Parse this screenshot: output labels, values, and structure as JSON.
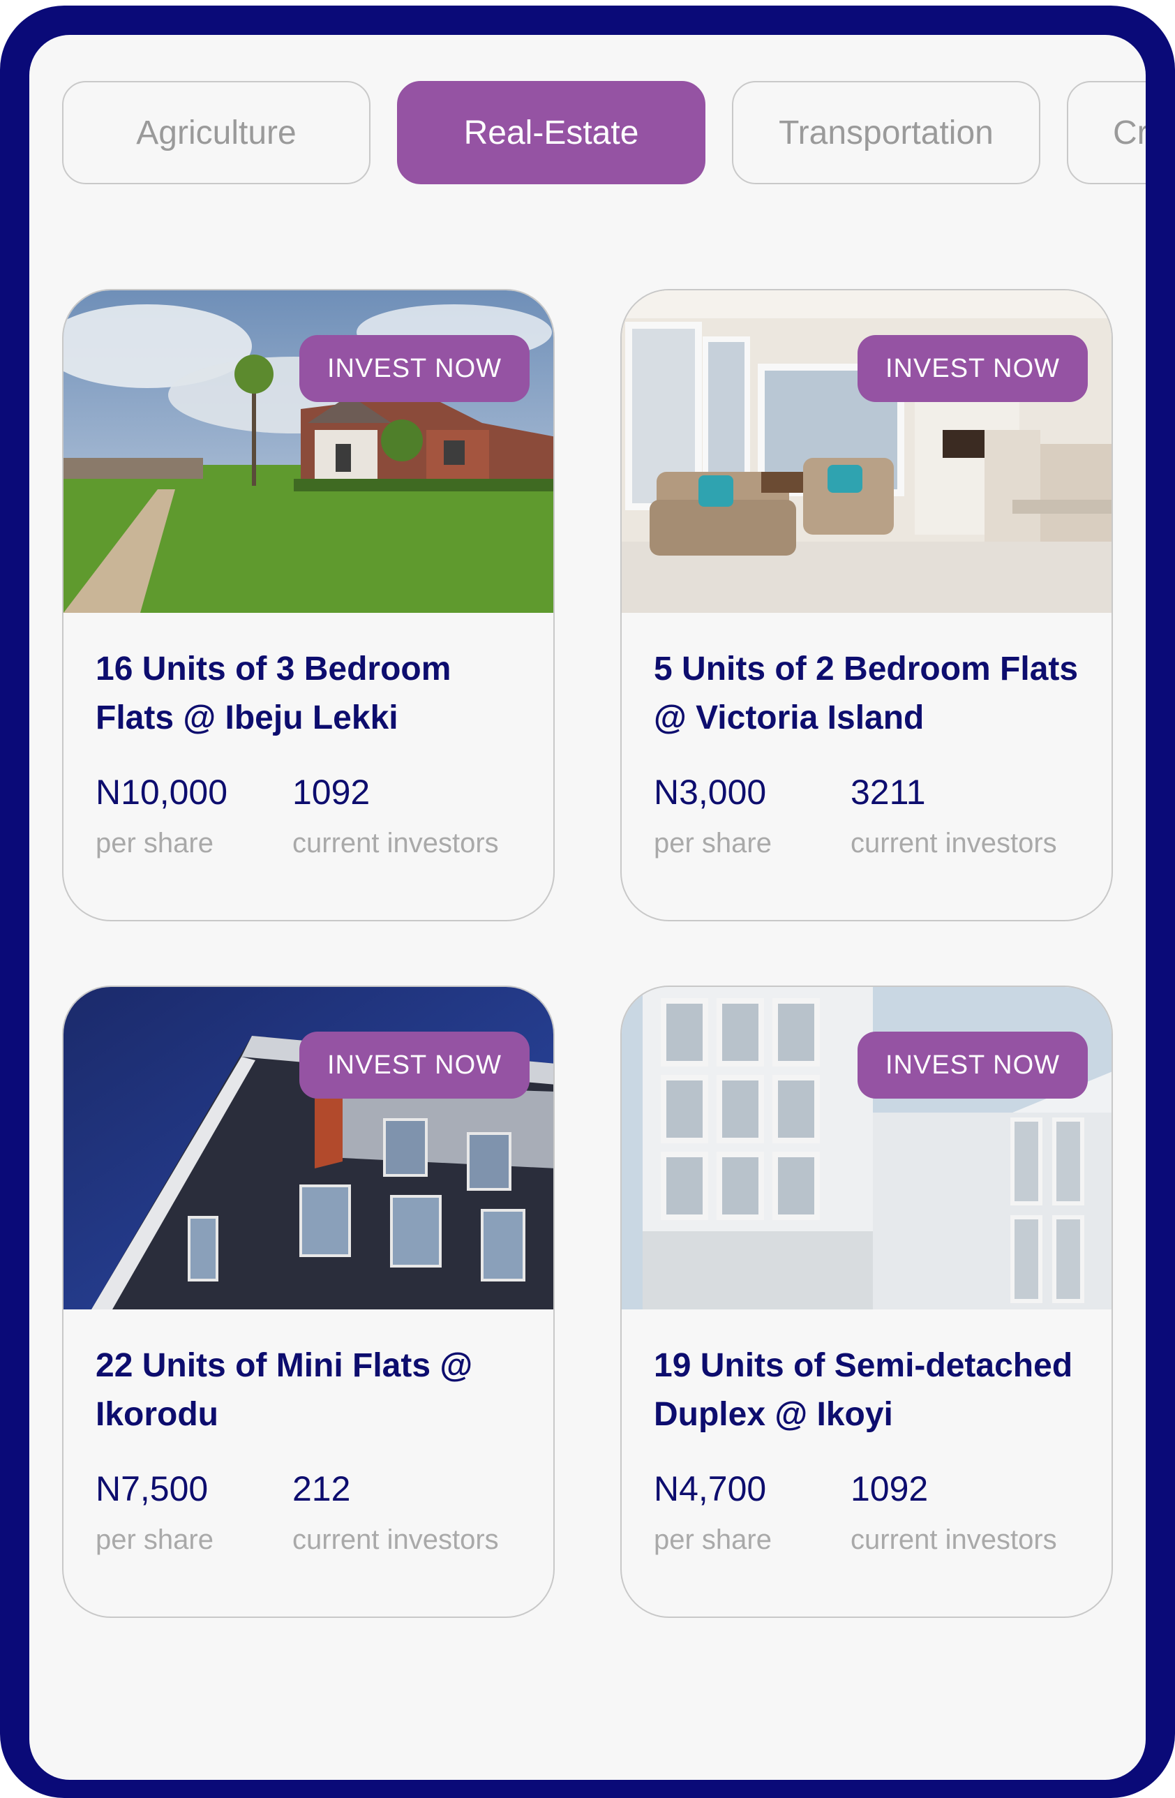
{
  "tabs": [
    {
      "label": "Agriculture",
      "active": false
    },
    {
      "label": "Real-Estate",
      "active": true
    },
    {
      "label": "Transportation",
      "active": false
    },
    {
      "label": "Cr",
      "active": false
    }
  ],
  "colors": {
    "frame": "#0a0a78",
    "accent": "#9553a3",
    "title_text": "#0d0d6e",
    "muted_text": "#a9a9a9",
    "background": "#f7f7f7"
  },
  "cards": [
    {
      "button": "INVEST NOW",
      "title": "16 Units of 3 Bedroom Flats @ Ibeju Lekki",
      "price": "N10,000",
      "price_label": "per share",
      "investors": "1092",
      "investors_label": "current investors"
    },
    {
      "button": "INVEST NOW",
      "title": "5 Units of 2 Bedroom Flats @ Victoria Island",
      "price": "N3,000",
      "price_label": "per share",
      "investors": "3211",
      "investors_label": "current investors"
    },
    {
      "button": "INVEST NOW",
      "title": "22 Units of Mini Flats @ Ikorodu",
      "price": "N7,500",
      "price_label": "per share",
      "investors": "212",
      "investors_label": "current investors"
    },
    {
      "button": "INVEST NOW",
      "title": "19 Units of Semi-detached Duplex @ Ikoyi",
      "price": "N4,700",
      "price_label": "per share",
      "investors": "1092",
      "investors_label": "current investors"
    }
  ]
}
